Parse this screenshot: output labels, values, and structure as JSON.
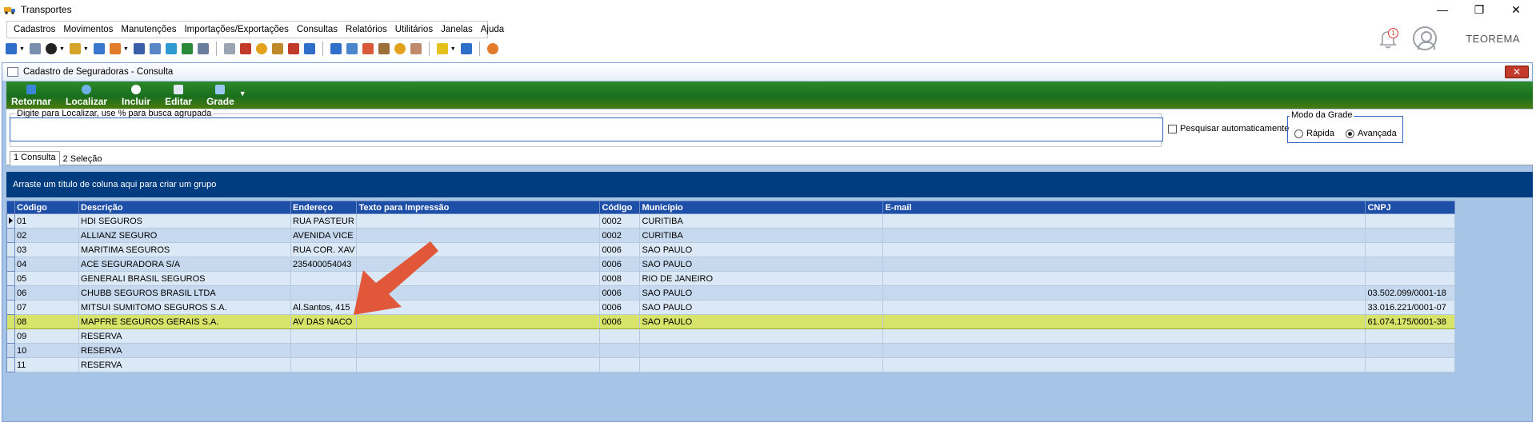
{
  "app": {
    "title": "Transportes",
    "company": "TEOREMA",
    "notification_count": "1"
  },
  "menu": [
    {
      "label": "Cadastros"
    },
    {
      "label": "Movimentos"
    },
    {
      "label": "Manutenções"
    },
    {
      "label": "Importações/Exportações"
    },
    {
      "label": "Consultas"
    },
    {
      "label": "Relatórios"
    },
    {
      "label": "Utilitários"
    },
    {
      "label": "Janelas"
    },
    {
      "label": "Ajuda"
    }
  ],
  "window": {
    "title": "Cadastro de Seguradoras - Consulta"
  },
  "actions": {
    "retornar": "Retornar",
    "localizar": "Localizar",
    "incluir": "Incluir",
    "editar": "Editar",
    "grade": "Grade"
  },
  "search": {
    "legend": "Digite para Localizar, use % para busca agrupada",
    "value": "",
    "auto_label": "Pesquisar automaticamente",
    "mode_legend": "Modo da Grade",
    "mode_rapida": "Rápida",
    "mode_avancada": "Avançada",
    "selected_mode": "Avançada"
  },
  "tabs": [
    {
      "label": "1 Consulta"
    },
    {
      "label": "2 Seleção"
    }
  ],
  "group_panel_text": "Arraste um título de coluna aqui para criar um grupo",
  "grid": {
    "columns": [
      "Código",
      "Descrição",
      "Endereço",
      "Texto para Impressão",
      "Código",
      "Município",
      "E-mail",
      "CNPJ"
    ],
    "rows": [
      [
        "01",
        "HDI SEGUROS",
        "RUA PASTEUR",
        "",
        "0002",
        "CURITIBA",
        "",
        ""
      ],
      [
        "02",
        "ALLIANZ SEGURO",
        "AVENIDA VICE",
        "",
        "0002",
        "CURITIBA",
        "",
        ""
      ],
      [
        "03",
        "MARITIMA SEGUROS",
        "RUA COR. XAV",
        "",
        "0006",
        "SAO PAULO",
        "",
        ""
      ],
      [
        "04",
        "ACE SEGURADORA S/A",
        "235400054043",
        "",
        "0006",
        "SAO PAULO",
        "",
        ""
      ],
      [
        "05",
        "GENERALI BRASIL SEGUROS",
        "",
        "",
        "0008",
        "RIO DE JANEIRO",
        "",
        ""
      ],
      [
        "06",
        "CHUBB SEGUROS BRASIL LTDA",
        "",
        "",
        "0006",
        "SAO PAULO",
        "",
        "03.502.099/0001-18"
      ],
      [
        "07",
        "MITSUI SUMITOMO SEGUROS S.A.",
        "Al.Santos, 415",
        "",
        "0006",
        "SAO PAULO",
        "",
        "33.016.221/0001-07"
      ],
      [
        "08",
        "MAPFRE SEGUROS GERAIS S.A.",
        "AV DAS NACO",
        "",
        "0006",
        "SAO PAULO",
        "",
        "61.074.175/0001-38"
      ],
      [
        "09",
        "RESERVA",
        "",
        "",
        "",
        "",
        "",
        ""
      ],
      [
        "10",
        "RESERVA",
        "",
        "",
        "",
        "",
        "",
        ""
      ],
      [
        "11",
        "RESERVA",
        "",
        "",
        "",
        "",
        "",
        ""
      ]
    ],
    "current_row": 0,
    "selected_row": 7
  },
  "colors": {
    "accent": "#1e4fa8",
    "highlight": "#d8e36a",
    "annotation": "#e0573a"
  }
}
